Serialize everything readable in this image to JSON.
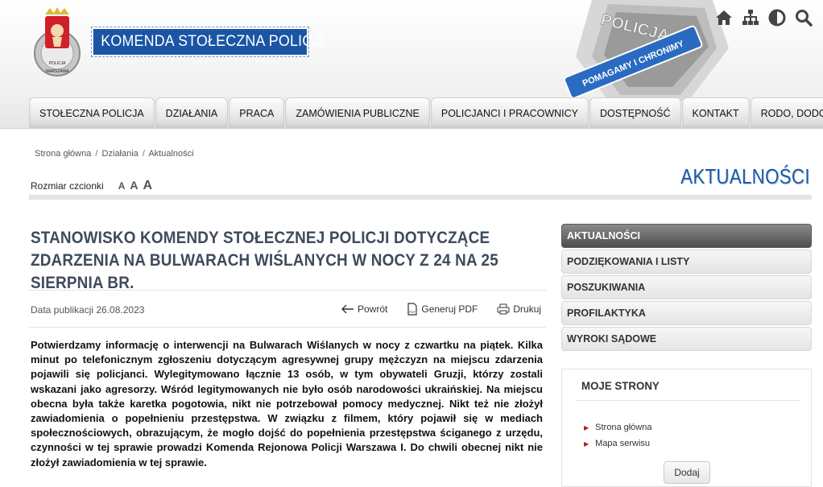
{
  "header": {
    "site_title": "KOMENDA STOŁECZNA POLICJI",
    "logo_text_top": "POLICJA",
    "logo_text_bottom": "WARSZAWA",
    "badge_text_top": "POLICJA",
    "badge_text_ribbon": "POMAGAMY I CHRONIMY",
    "icons": [
      "home-icon",
      "sitemap-icon",
      "contrast-icon",
      "search-icon"
    ]
  },
  "nav": [
    "STOŁECZNA POLICJA",
    "DZIAŁANIA",
    "PRACA",
    "ZAMÓWIENIA PUBLICZNE",
    "POLICJANCI I PRACOWNICY",
    "DOSTĘPNOŚĆ",
    "KONTAKT",
    "RODO, DODO"
  ],
  "breadcrumb": [
    "Strona główna",
    "Działania",
    "Aktualności"
  ],
  "font_size": {
    "label": "Rozmiar czcionki",
    "small": "A",
    "medium": "A",
    "large": "A"
  },
  "section_title": "AKTUALNOŚCI",
  "article": {
    "title": "STANOWISKO KOMENDY STOŁECZNEJ POLICJI DOTYCZĄCE ZDARZENIA NA BULWARACH WIŚLANYCH W NOCY Z 24 NA 25 SIERPNIA BR.",
    "pubdate": "Data publikacji 26.08.2023",
    "tools": {
      "back": "Powrót",
      "pdf": "Generuj PDF",
      "print": "Drukuj"
    },
    "body": "Potwierdzamy informację o interwencji na Bulwarach Wiślanych w nocy z czwartku na piątek. Kilka minut po telefonicznym zgłoszeniu dotyczącym agresywnej grupy mężczyzn na miejscu zdarzenia pojawili się policjanci. Wylegitymowano łącznie 13 osób, w tym obywateli Gruzji, którzy zostali wskazani jako agresorzy. Wśród legitymowanych nie było osób narodowości ukraińskiej. Na miejscu obecna była także karetka pogotowia, nikt nie potrzebował pomocy medycznej. Nikt też nie złożył zawiadomienia o popełnieniu przestępstwa. W związku z filmem, który pojawił się w mediach społecznościowych, obrazującym, że mogło dojść do popełnienia przestępstwa ściganego z urzędu, czynności w tej sprawie prowadzi Komenda Rejonowa Policji Warszawa I. Do chwili obecnej nikt nie złożył zawiadomienia w tej sprawie."
  },
  "sidebar": {
    "menu": [
      "AKTUALNOŚCI",
      "PODZIĘKOWANIA I LISTY",
      "POSZUKIWANIA",
      "PROFILAKTYKA",
      "WYROKI SĄDOWE"
    ],
    "active_index": 0,
    "my_pages": {
      "title": "MOJE STRONY",
      "links": [
        "Strona główna",
        "Mapa serwisu"
      ],
      "add_label": "Dodaj"
    }
  },
  "colors": {
    "brand_blue": "#1b55a5",
    "title_gray": "#3f4b5b",
    "bullet_red": "#c0151d"
  }
}
